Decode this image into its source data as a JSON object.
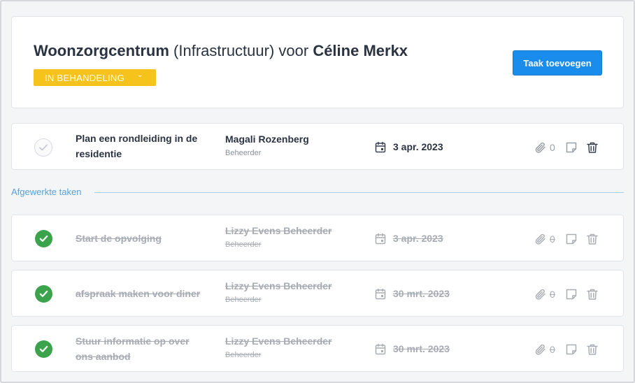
{
  "header": {
    "title_facility": "Woonzorgcentrum",
    "title_category": " (Infrastructuur) voor ",
    "title_person": "Céline Merkx",
    "status_label": "IN BEHANDELING",
    "add_task_label": "Taak toevoegen"
  },
  "colors": {
    "accent": "#1a8ceb",
    "status": "#f6c21c",
    "done": "#3aa34b"
  },
  "open_tasks": [
    {
      "title": "Plan een rondleiding in de residentie",
      "assignee": "Magali Rozenberg",
      "role": "Beheerder",
      "due": "3 apr. 2023",
      "attachments": "0"
    }
  ],
  "completed_section_label": "Afgewerkte taken",
  "completed_tasks": [
    {
      "title": "Start de opvolging",
      "assignee": "Lizzy Evens Beheerder",
      "role": "Beheerder",
      "due": "3 apr. 2023",
      "attachments": "0"
    },
    {
      "title": "afspraak maken voor diner",
      "assignee": "Lizzy Evens Beheerder",
      "role": "Beheerder",
      "due": "30 mrt. 2023",
      "attachments": "0"
    },
    {
      "title": "Stuur informatie op over ons aanbod",
      "assignee": "Lizzy Evens Beheerder",
      "role": "Beheerder",
      "due": "30 mrt. 2023",
      "attachments": "0"
    }
  ],
  "icons": [
    "check-icon",
    "calendar-icon",
    "paperclip-icon",
    "note-icon",
    "trash-icon",
    "chevron-down-icon"
  ]
}
